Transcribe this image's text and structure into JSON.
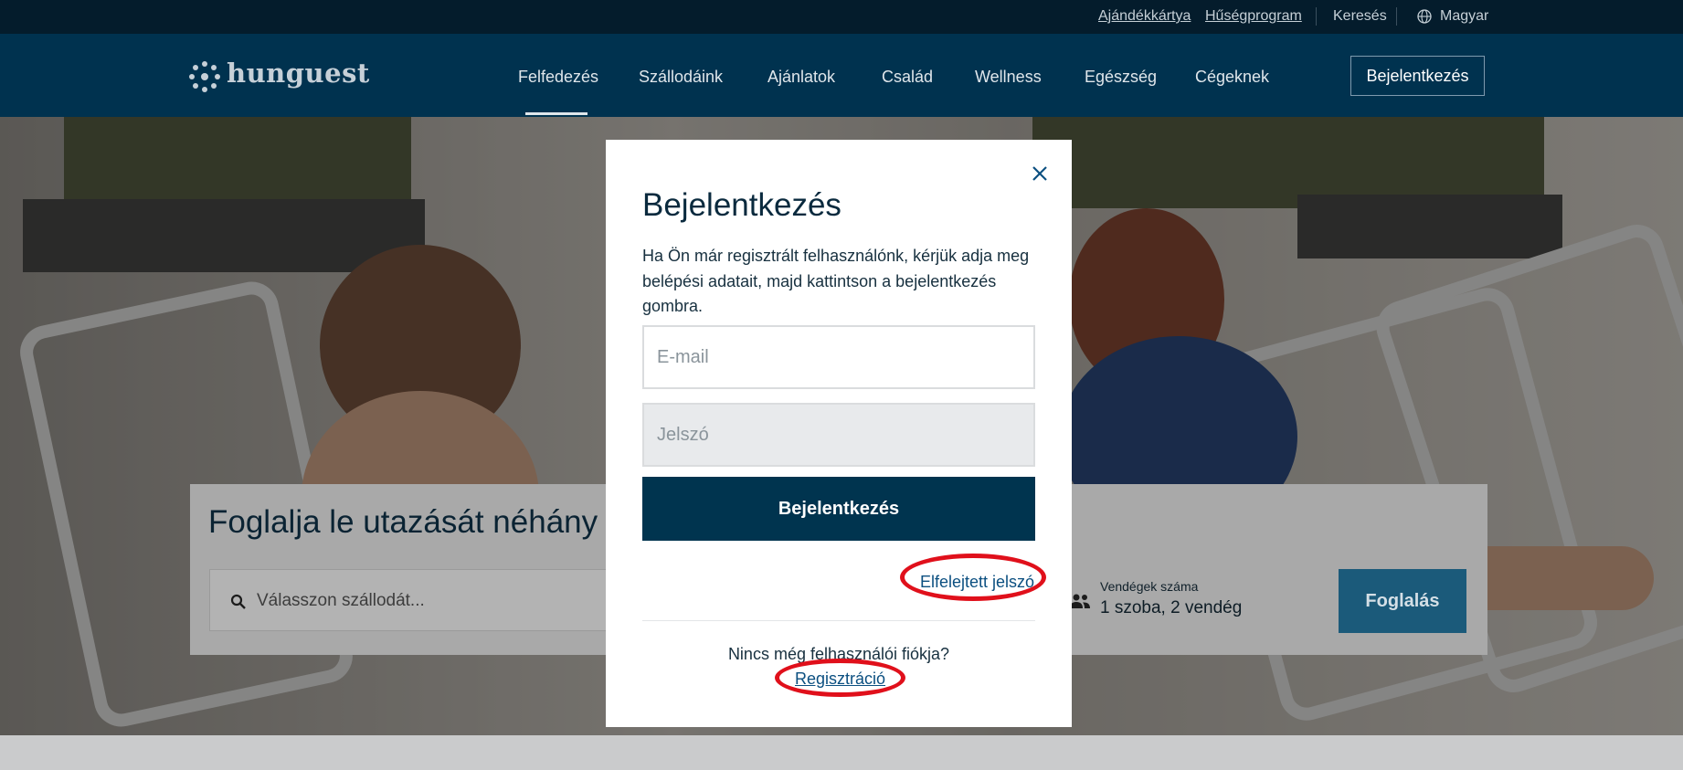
{
  "topbar": {
    "gift_card": "Ajándékkártya",
    "loyalty": "Hűségprogram",
    "search": "Keresés",
    "language": "Magyar"
  },
  "brand": {
    "logo_text": "hunguest"
  },
  "nav": {
    "items": [
      "Felfedezés",
      "Szállodáink",
      "Ajánlatok",
      "Család",
      "Wellness",
      "Egészség",
      "Cégeknek"
    ],
    "active": "Felfedezés",
    "login_label": "Bejelentkezés"
  },
  "booking": {
    "title": "Foglalja le utazását néhány",
    "hotel_placeholder": "Válasszon szállodát...",
    "guests_label": "Vendégek száma",
    "guests_value": "1 szoba, 2 vendég",
    "book_label": "Foglalás"
  },
  "modal": {
    "title": "Bejelentkezés",
    "description": "Ha Ön már regisztrált felhasználónk, kérjük adja meg belépési adatait, majd kattintson a bejelentkezés gombra.",
    "email_placeholder": "E-mail",
    "password_placeholder": "Jelszó",
    "submit_label": "Bejelentkezés",
    "forgot_password": "Elfelejtett jelszó",
    "no_account": "Nincs még felhasználói fiókja?",
    "register": "Regisztráció"
  },
  "colors": {
    "navy": "#00324f",
    "top_bar": "#041c2c",
    "link": "#0b4f80",
    "highlight_ring": "#e0101b"
  },
  "icons": [
    "globe-icon",
    "hunguest-logo-icon",
    "search-icon",
    "chevron-down-icon",
    "people-icon",
    "close-icon"
  ]
}
